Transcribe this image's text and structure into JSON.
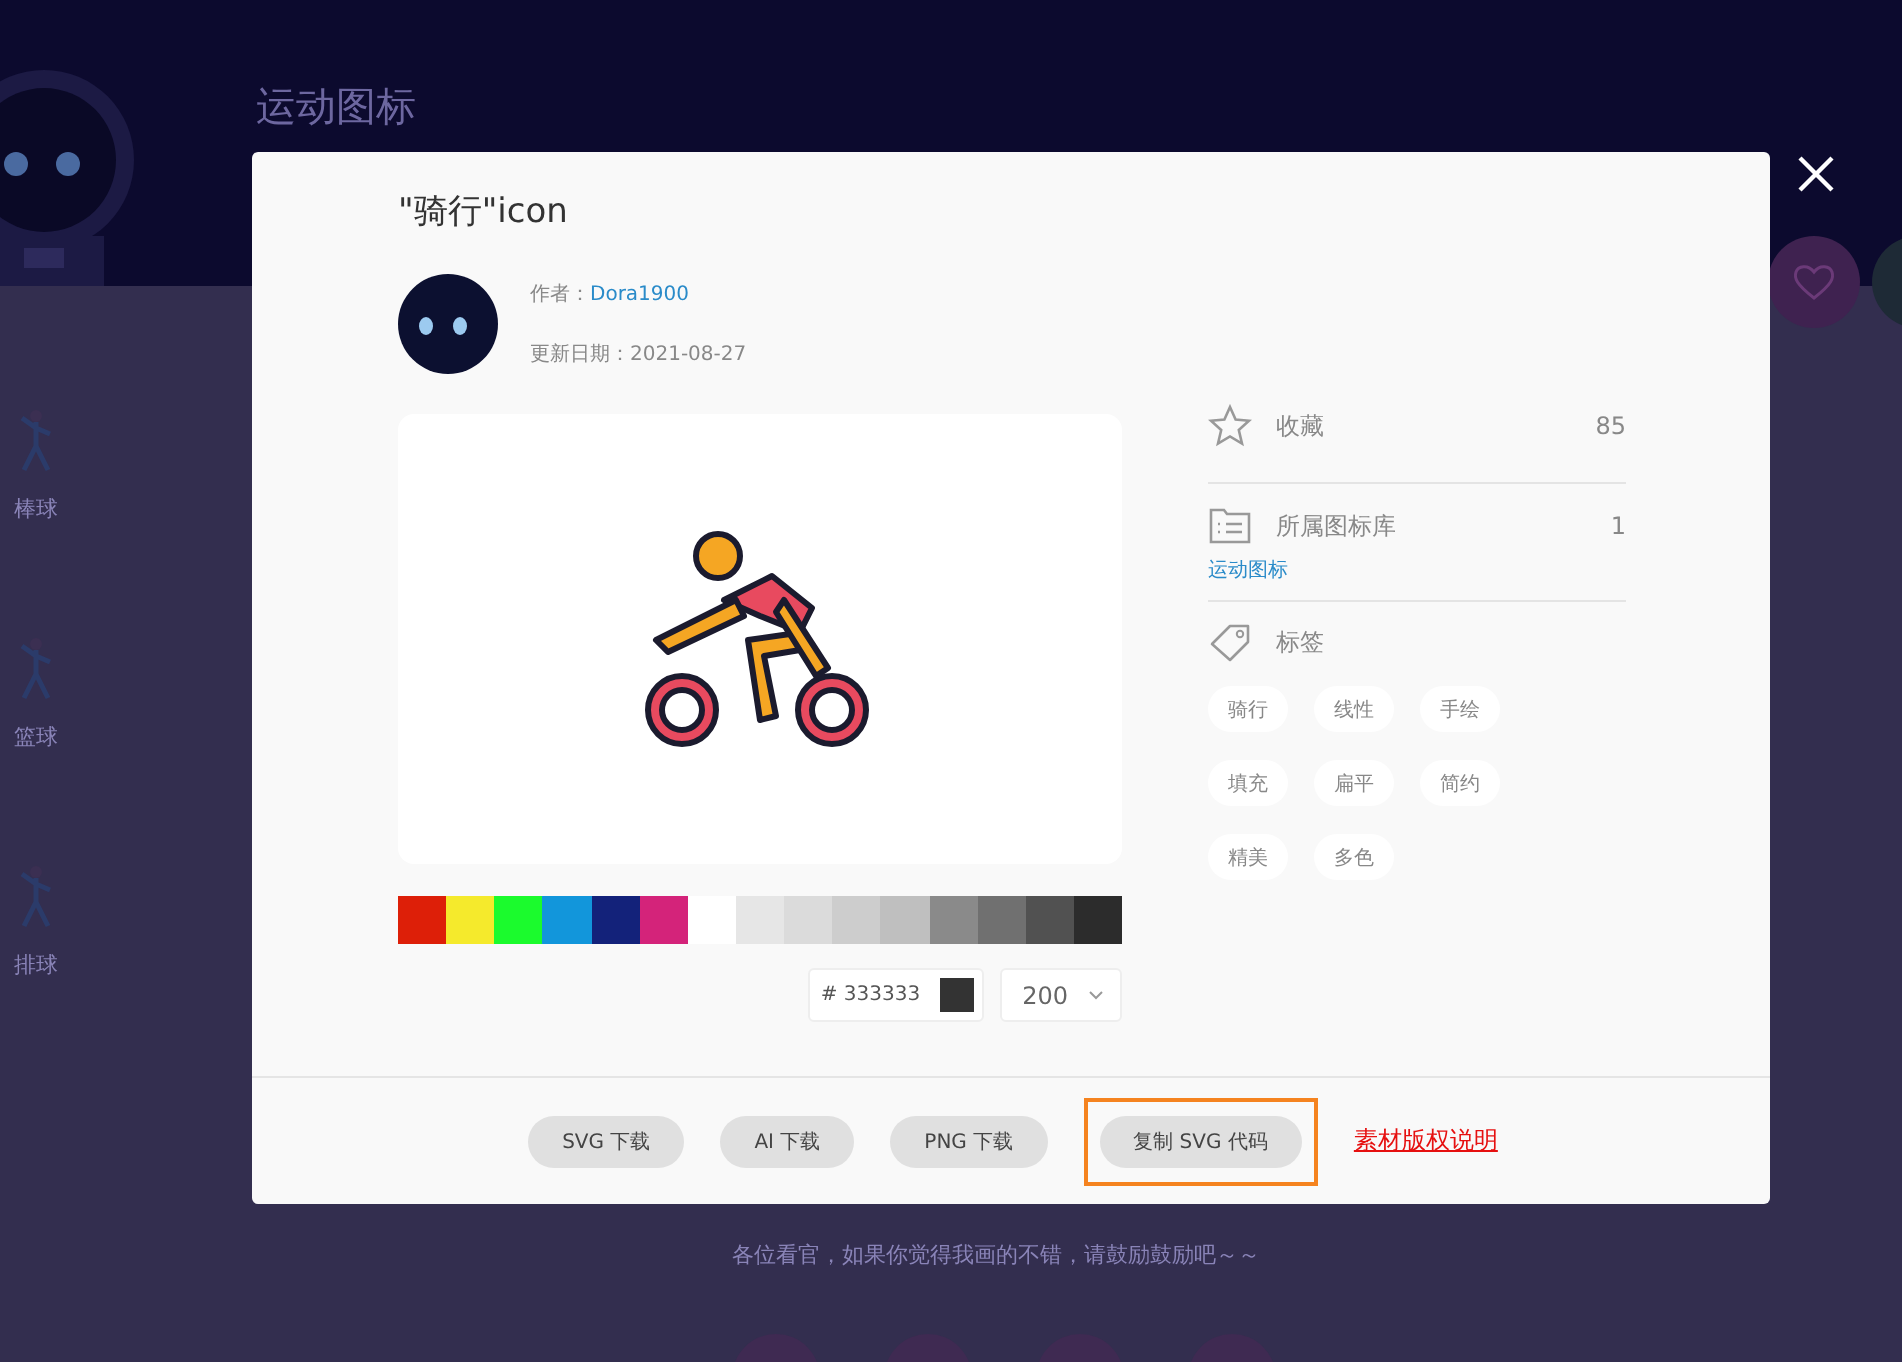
{
  "page": {
    "title": "运动图标",
    "icons": [
      {
        "label": "棒球"
      },
      {
        "label": "篮球"
      },
      {
        "label": "排球"
      }
    ],
    "footer_text": "各位看官，如果你觉得我画的不错，请鼓励鼓励吧～～"
  },
  "modal": {
    "title": "\"骑行\"icon",
    "author_label": "作者：",
    "author": "Dora1900",
    "date_label": "更新日期：",
    "date": "2021-08-27",
    "palette": [
      {
        "color": "#dd1f08"
      },
      {
        "color": "#f5ea2c"
      },
      {
        "color": "#1bfb2d"
      },
      {
        "color": "#1296db"
      },
      {
        "color": "#13227a"
      },
      {
        "color": "#d4237a"
      },
      {
        "color": "#ffffff"
      },
      {
        "color": "#e6e6e6"
      },
      {
        "color": "#dbdbdb"
      },
      {
        "color": "#cdcdcd"
      },
      {
        "color": "#bfbfbf"
      },
      {
        "color": "#8a8a8a"
      },
      {
        "color": "#707070"
      },
      {
        "color": "#515151"
      },
      {
        "color": "#2c2c2c"
      }
    ],
    "color_field": {
      "prefix": "#",
      "value": "333333"
    },
    "size_select": {
      "value": "200"
    },
    "buttons": [
      {
        "label": "SVG 下载",
        "highlighted": false
      },
      {
        "label": "AI 下载",
        "highlighted": false
      },
      {
        "label": "PNG 下载",
        "highlighted": false
      },
      {
        "label": "复制 SVG 代码",
        "highlighted": true
      }
    ],
    "license_link": "素材版权说明",
    "favorites": {
      "label": "收藏",
      "count": "85"
    },
    "library": {
      "label": "所属图标库",
      "count": "1",
      "link": "运动图标"
    },
    "tags_label": "标签",
    "tags": [
      "骑行",
      "线性",
      "手绘",
      "填充",
      "扁平",
      "简约",
      "精美",
      "多色"
    ]
  }
}
